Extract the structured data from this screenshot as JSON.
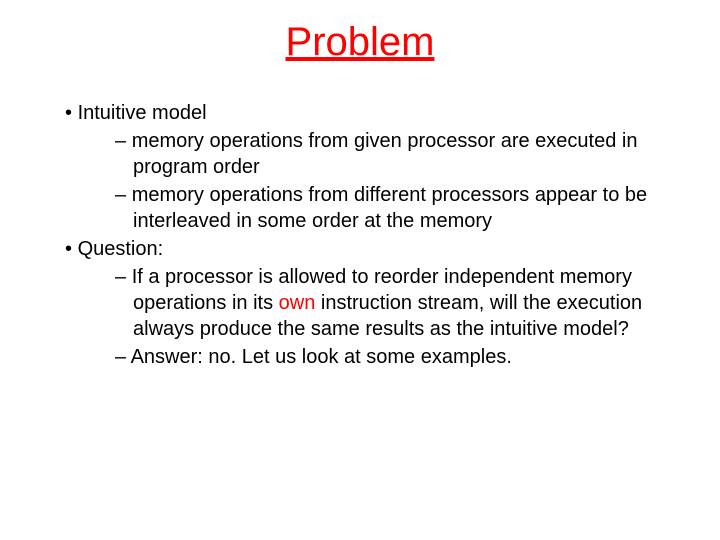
{
  "title": "Problem",
  "items": {
    "l1_1": "Intuitive model",
    "l2_1": "memory operations from given processor are executed in program order",
    "l2_2": "memory operations from different processors appear to be interleaved in some order at the memory",
    "l1_2": "Question:",
    "l2_3a": "If a processor is allowed to reorder independent memory operations in its ",
    "l2_3_red": "own",
    "l2_3b": " instruction stream, will the execution always produce the same results as the intuitive model?",
    "l2_4": "Answer: no. Let us look at some examples."
  }
}
